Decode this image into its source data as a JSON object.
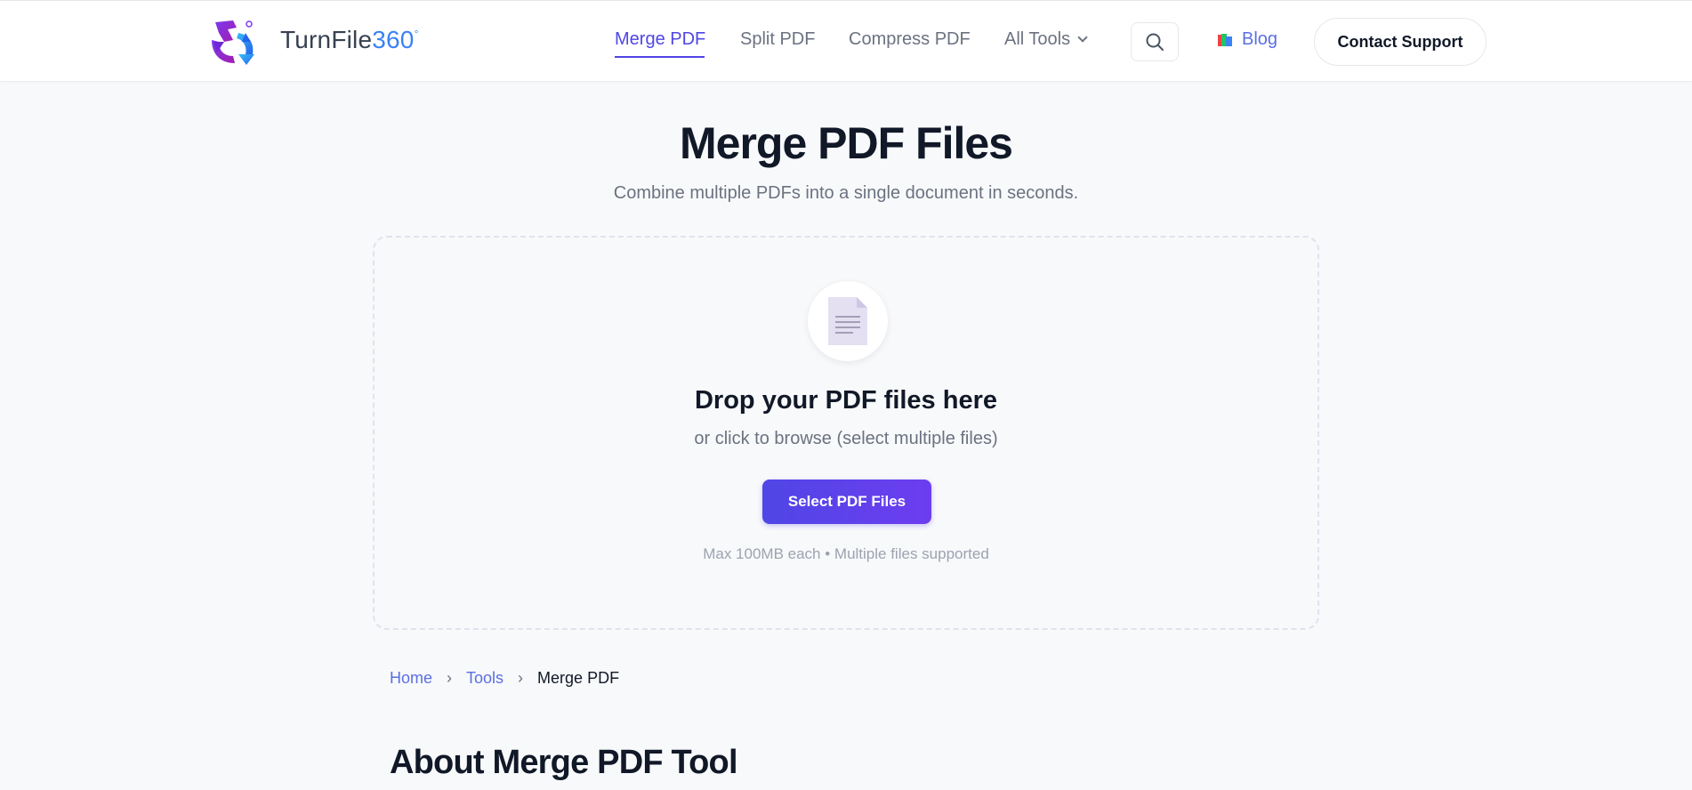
{
  "header": {
    "brand_name": "TurnFile",
    "brand_number": "360",
    "brand_mark": "°",
    "nav": [
      {
        "label": "Merge PDF",
        "active": true
      },
      {
        "label": "Split PDF",
        "active": false
      },
      {
        "label": "Compress PDF",
        "active": false
      },
      {
        "label": "All Tools",
        "active": false
      }
    ],
    "search_icon": "search-icon",
    "blog_label": "Blog",
    "contact_label": "Contact Support"
  },
  "main": {
    "title": "Merge PDF Files",
    "subtitle": "Combine multiple PDFs into a single document in seconds."
  },
  "dropzone": {
    "icon": "document-icon",
    "title": "Drop your PDF files here",
    "subtitle": "or click to browse (select multiple files)",
    "button_label": "Select PDF Files",
    "note": "Max 100MB each • Multiple files supported"
  },
  "breadcrumb": {
    "items": [
      "Home",
      "Tools"
    ],
    "separator": "›",
    "current": "Merge PDF"
  },
  "about": {
    "title": "About Merge PDF Tool"
  },
  "colors": {
    "accent": "#4f46e5",
    "link": "#5b6fe0",
    "brand_blue": "#3b82f6"
  }
}
